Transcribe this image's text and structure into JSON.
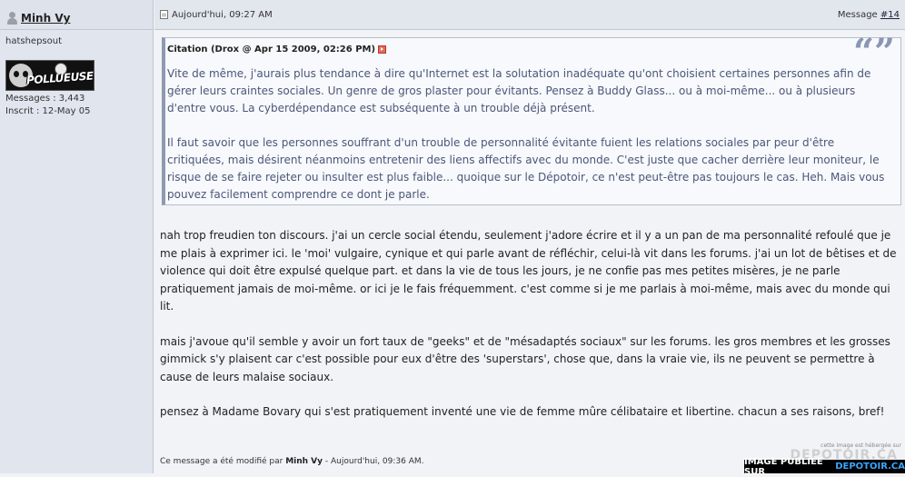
{
  "sidebar": {
    "username": "Minh Vy",
    "user_title": "hatshepsout",
    "avatar_text": "POLLUEUSE",
    "messages": "Messages : 3,443",
    "joined": "Inscrit : 12-May 05"
  },
  "post_header": {
    "date": "Aujourd'hui, 09:27 AM",
    "message_label": "Message",
    "message_number": "#14"
  },
  "quote": {
    "citation": "Citation (Drox @ Apr 15 2009, 02:26 PM)",
    "paragraphs": [
      "Vite de même, j'aurais plus tendance à dire qu'Internet est la solutation inadéquate qu'ont choisient certaines personnes afin de gérer leurs craintes sociales. Un genre de gros plaster pour évitants. Pensez à Buddy Glass... ou à moi-même... ou à plusieurs d'entre vous. La cyberdépendance est subséquente à un trouble déjà présent.",
      "Il faut savoir que les personnes souffrant d'un trouble de personnalité évitante fuient les relations sociales par peur d'être critiquées, mais désirent néanmoins entretenir des liens affectifs avec du monde. C'est juste que cacher derrière leur moniteur, le risque de se faire rejeter ou insulter est plus faible... quoique sur le Dépotoir, ce n'est peut-être pas toujours le cas. Heh. Mais vous pouvez facilement comprendre ce dont je parle."
    ]
  },
  "post_body": {
    "paragraphs": [
      "nah trop freudien ton discours. j'ai un cercle social étendu, seulement j'adore écrire et il y a un pan de ma personnalité refoulé que je me plais à exprimer ici. le 'moi' vulgaire, cynique et qui parle avant de réfléchir, celui-là vit dans les forums. j'ai un lot de bêtises et de violence qui doit être expulsé quelque part. et dans la vie de tous les jours, je ne confie pas mes petites misères, je ne parle pratiquement jamais de moi-même. or ici je le fais fréquemment. c'est comme si je me parlais à moi-même, mais avec du monde qui lit.",
      "mais j'avoue qu'il semble y avoir un fort taux de \"geeks\" et de \"mésadaptés sociaux\" sur les forums. les gros membres et les grosses gimmick s'y plaisent car c'est possible pour eux d'être des 'superstars', chose que, dans la vraie vie, ils ne peuvent se permettre à cause de leurs malaise sociaux.",
      "pensez à Madame Bovary qui s'est pratiquement inventé une vie de femme mûre célibataire et libertine. chacun a ses raisons, bref!"
    ]
  },
  "edit_note": {
    "prefix": "Ce message a été modifié par",
    "editor": "Minh Vy",
    "suffix": "- Aujourd'hui, 09:36 AM."
  },
  "watermark": {
    "line1": "cette image est hébergée sur",
    "big": "DEPOTOIR.CA",
    "banner_prefix": "IMAGE PUBLIÉE SUR",
    "banner_site": "DEPOTOIR.CA"
  },
  "colors": {
    "sidebar_bg": "#e0e5ee",
    "quote_text": "#4c5678",
    "banner_site": "#3aa7ff"
  }
}
